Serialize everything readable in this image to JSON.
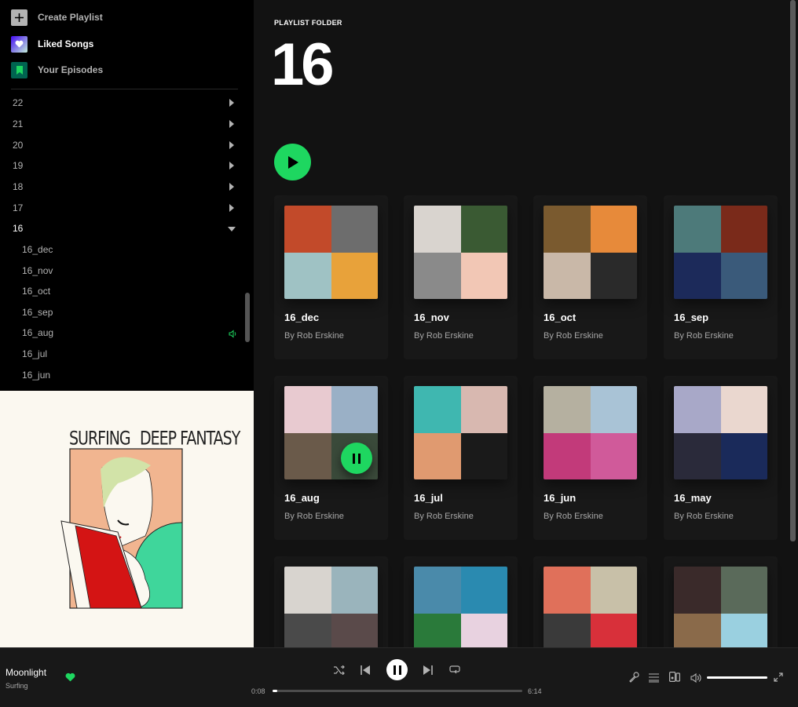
{
  "sidebar": {
    "actions": [
      {
        "label": "Create Playlist",
        "icon": "plus-icon"
      },
      {
        "label": "Liked Songs",
        "icon": "heart-icon"
      },
      {
        "label": "Your Episodes",
        "icon": "bookmark-icon"
      }
    ],
    "folders": [
      "22",
      "21",
      "20",
      "19",
      "18",
      "17",
      "16"
    ],
    "open_folder_playlists": [
      "16_dec",
      "16_nov",
      "16_oct",
      "16_sep",
      "16_aug",
      "16_jul",
      "16_jun"
    ],
    "playing_playlist": "16_aug"
  },
  "now_playing_cover": {
    "left_text": "SURFING",
    "right_text": "DEEP FANTASY"
  },
  "main": {
    "folder_label": "PLAYLIST FOLDER",
    "folder_title": "16",
    "cards": [
      {
        "title": "16_dec",
        "subtitle": "By Rob Erskine",
        "colors": [
          "#c24a2a",
          "#6d6d6d",
          "#9fc2c4",
          "#e8a23a"
        ]
      },
      {
        "title": "16_nov",
        "subtitle": "By Rob Erskine",
        "colors": [
          "#d9d4cf",
          "#3a5a33",
          "#8a8a8a",
          "#f2c7b5"
        ]
      },
      {
        "title": "16_oct",
        "subtitle": "By Rob Erskine",
        "colors": [
          "#7a5a2f",
          "#e78a3a",
          "#c9b8a8",
          "#2a2a2a"
        ]
      },
      {
        "title": "16_sep",
        "subtitle": "By Rob Erskine",
        "colors": [
          "#4d7a7a",
          "#7a2a1a",
          "#1c2a5a",
          "#3a5a7a"
        ]
      },
      {
        "title": "16_aug",
        "subtitle": "By Rob Erskine",
        "colors": [
          "#e8cad0",
          "#9ab0c6",
          "#6a5a4a",
          "#3a4a3a"
        ]
      },
      {
        "title": "16_jul",
        "subtitle": "By Rob Erskine",
        "colors": [
          "#3fb7b0",
          "#d8b8b0",
          "#e09a70",
          "#1a1a1a"
        ]
      },
      {
        "title": "16_jun",
        "subtitle": "By Rob Erskine",
        "colors": [
          "#b5b0a0",
          "#a9c3d6",
          "#c23a7a",
          "#d05a9a"
        ]
      },
      {
        "title": "16_may",
        "subtitle": "By Rob Erskine",
        "colors": [
          "#a8a8c8",
          "#ead7cf",
          "#2a2a3a",
          "#1a2a5a"
        ]
      },
      {
        "title": "",
        "subtitle": "",
        "colors": [
          "#d8d4cf",
          "#9ab4bc",
          "#4a4a4a",
          "#5a4a4a"
        ]
      },
      {
        "title": "",
        "subtitle": "",
        "colors": [
          "#4a8aaa",
          "#2a8ab0",
          "#2a7a3a",
          "#e8d2e0"
        ]
      },
      {
        "title": "",
        "subtitle": "",
        "colors": [
          "#e0705a",
          "#c8c0a8",
          "#3a3a3a",
          "#d8303a"
        ]
      },
      {
        "title": "",
        "subtitle": "",
        "colors": [
          "#3a2a2a",
          "#5a6a5a",
          "#8a6a4a",
          "#9ad0e0"
        ]
      }
    ]
  },
  "player": {
    "track_title": "Moonlight",
    "track_artist": "Surfing",
    "time_current": "0:08",
    "time_total": "6:14",
    "progress_fraction": 0.02,
    "volume_fraction": 1.0,
    "liked": true
  },
  "colors": {
    "accent": "#1ed760",
    "background": "#121212",
    "sidebar": "#000000"
  }
}
